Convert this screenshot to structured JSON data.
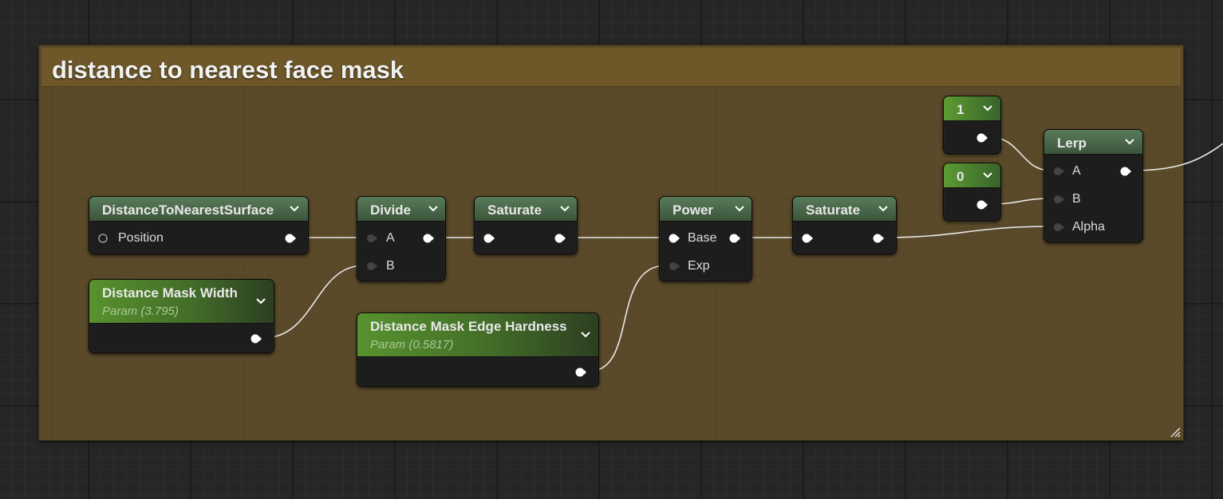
{
  "comment": {
    "title": "distance to nearest face mask"
  },
  "nodes": {
    "distance_to_nearest_surface": {
      "title": "DistanceToNearestSurface",
      "input": "Position"
    },
    "distance_mask_width": {
      "title": "Distance Mask Width",
      "subtitle": "Param (3.795)"
    },
    "divide": {
      "title": "Divide",
      "input_a": "A",
      "input_b": "B"
    },
    "saturate_1": {
      "title": "Saturate"
    },
    "distance_mask_edge_hardness": {
      "title": "Distance Mask Edge Hardness",
      "subtitle": "Param (0.5817)"
    },
    "power": {
      "title": "Power",
      "input_base": "Base",
      "input_exp": "Exp"
    },
    "saturate_2": {
      "title": "Saturate"
    },
    "const_1": {
      "title": "1"
    },
    "const_0": {
      "title": "0"
    },
    "lerp": {
      "title": "Lerp",
      "input_a": "A",
      "input_b": "B",
      "input_alpha": "Alpha"
    }
  },
  "colors": {
    "comment_body": "#5a4a2a",
    "comment_header": "#6e5829",
    "node_body": "#1d1d1d",
    "param_header": "#58922e",
    "wire": "#e8e8e8"
  },
  "icons": [
    "chevron-down-icon",
    "pin-connected-icon",
    "pin-empty-icon",
    "resize-grip-icon"
  ]
}
